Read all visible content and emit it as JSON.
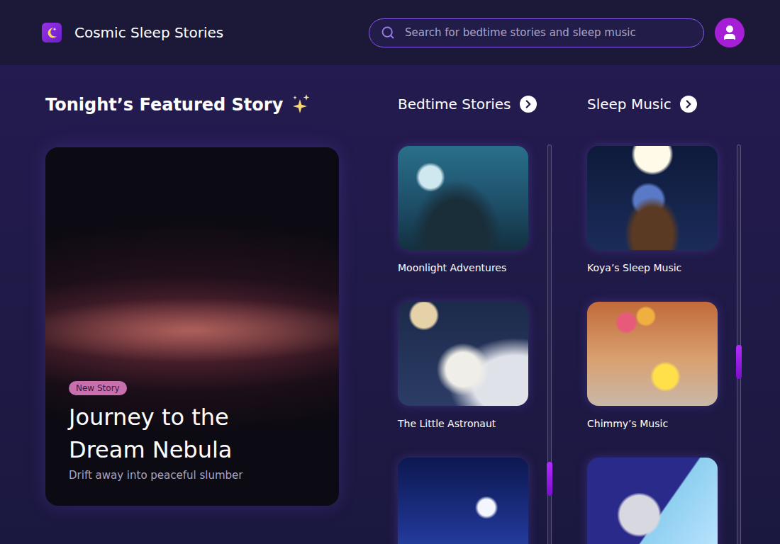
{
  "app": {
    "title": "Cosmic Sleep Stories"
  },
  "search": {
    "placeholder": "Search for bedtime stories and sleep music"
  },
  "featured": {
    "heading": "Tonight’s Featured Story",
    "badge": "New Story",
    "title": "Journey to the Dream Nebula",
    "subtitle": "Drift away into peaceful slumber"
  },
  "sections": [
    {
      "title": "Bedtime Stories",
      "scroll": {
        "level": 0.81
      },
      "items": [
        {
          "title": "Moonlight Adventures"
        },
        {
          "title": "The Little Astronaut"
        },
        {
          "title": ""
        }
      ]
    },
    {
      "title": "Sleep Music",
      "scroll": {
        "level": 0.51
      },
      "items": [
        {
          "title": "Koya’s Sleep Music"
        },
        {
          "title": "Chimmy’s Music"
        },
        {
          "title": ""
        }
      ]
    }
  ]
}
